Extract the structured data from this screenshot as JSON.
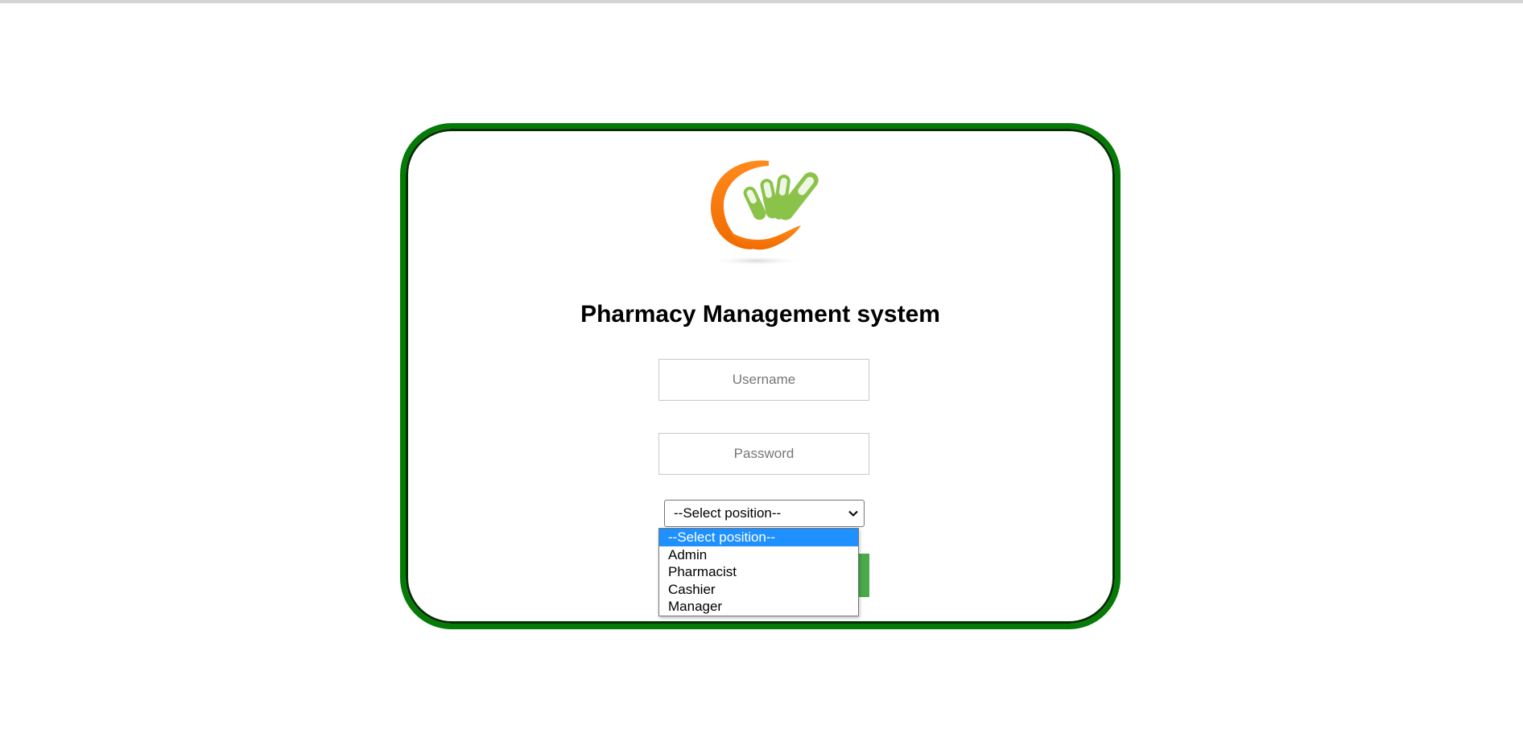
{
  "app": {
    "title": "Pharmacy Management system"
  },
  "login": {
    "username_placeholder": "Username",
    "username_value": "",
    "password_placeholder": "Password",
    "password_value": ""
  },
  "position_select": {
    "selected_label": "--Select position--",
    "options": [
      {
        "label": "--Select position--",
        "highlighted": true
      },
      {
        "label": "Admin",
        "highlighted": false
      },
      {
        "label": "Pharmacist",
        "highlighted": false
      },
      {
        "label": "Cashier",
        "highlighted": false
      },
      {
        "label": "Manager",
        "highlighted": false
      }
    ]
  },
  "colors": {
    "card_border": "#067a06",
    "login_button": "#4aaa4a",
    "highlight": "#1e90ff",
    "logo_orange": "#f47a10",
    "logo_green": "#8bc34a"
  },
  "icons": {
    "logo": "pharmacy-hand-pills-logo",
    "select_arrow": "chevron-down-icon"
  }
}
